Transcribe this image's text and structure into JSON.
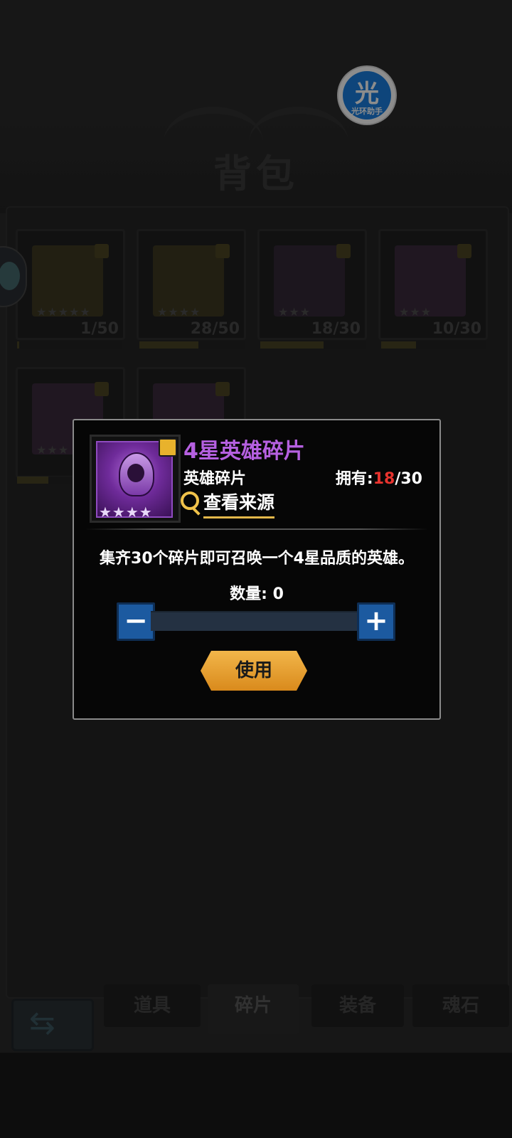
{
  "background": {
    "title": "背包",
    "slots": [
      {
        "count": "1/50",
        "stars": "★★★★★",
        "fill": 0.02
      },
      {
        "count": "28/50",
        "stars": "★★★★",
        "fill": 0.56
      },
      {
        "count": "18/30",
        "stars": "★★★",
        "fill": 0.6
      },
      {
        "count": "10/30",
        "stars": "★★★",
        "fill": 0.33
      },
      {
        "count": "",
        "stars": "★★★",
        "fill": 0.3
      },
      {
        "count": "",
        "stars": "",
        "fill": 0
      }
    ],
    "tabs": [
      "道具",
      "碎片",
      "装备",
      "魂石"
    ],
    "active_tab": "碎片"
  },
  "helper_app": {
    "glyph": "光",
    "caption": "光环助手"
  },
  "dialog": {
    "title": "4星英雄碎片",
    "type": "英雄碎片",
    "owned_label": "拥有:",
    "owned_current": "18",
    "owned_total": "/30",
    "source_button": "查看来源",
    "description": "集齐30个碎片即可召唤一个4星品质的英雄。",
    "quantity_label": "数量: 0",
    "quantity_value": 0,
    "minus_label": "−",
    "plus_label": "+",
    "use_button": "使用",
    "portrait_stars": "★★★★",
    "colors": {
      "title": "#b560e0",
      "owned_current": "#e8332e",
      "use_button": "#e9a535"
    }
  }
}
